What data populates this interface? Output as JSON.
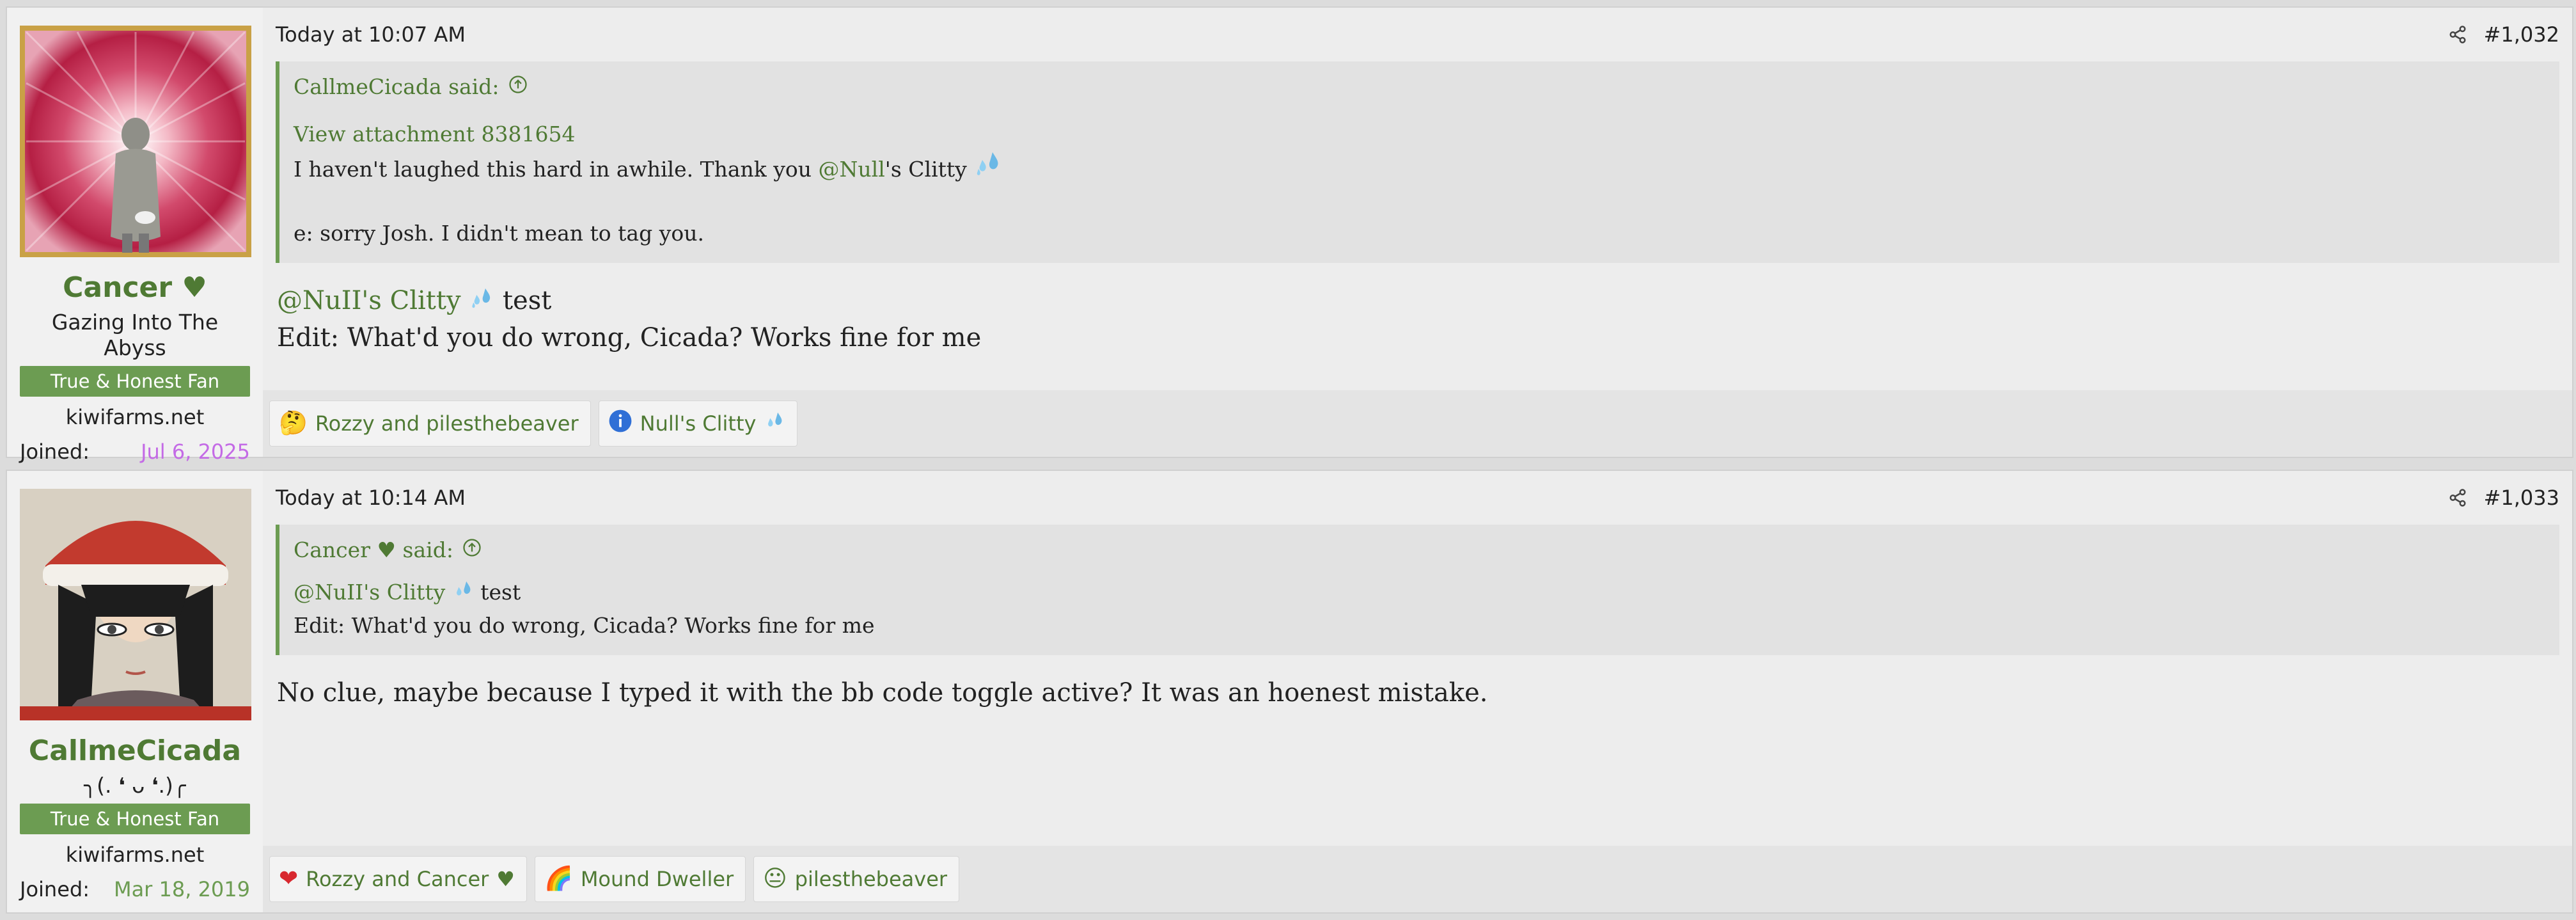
{
  "posts": [
    {
      "username": "Cancer",
      "username_heart": "♥",
      "user_title": "Gazing Into The Abyss",
      "banner": "True & Honest Fan",
      "site": "kiwifarms.net",
      "joined_label": "Joined:",
      "joined_date": "Jul 6, 2025",
      "timestamp": "Today at 10:07 AM",
      "post_number": "#1,032",
      "quote": {
        "author": "CallmeCicada said:",
        "attachment_link": "View attachment 8381654",
        "line1_pre": "I haven't laughed this hard in awhile. Thank you ",
        "mention": "@Null",
        "line1_post": "'s Clitty",
        "line2": "e: sorry Josh. I didn't mean to tag you."
      },
      "body_mention": "@NuII's Clitty",
      "body_line1_post": " test",
      "body_line2": "Edit: What'd you do wrong, Cicada? Works fine for me",
      "reactions": [
        {
          "icon": "thinking-emoji",
          "emoji": "🤔",
          "label": "Rozzy and pilesthebeaver"
        },
        {
          "icon": "info-icon",
          "emoji": "ℹ",
          "label": "Null's Clitty"
        }
      ]
    },
    {
      "username": "CallmeCicada",
      "user_title": "╮(. ❛ ᴗ ❛.)╭",
      "banner": "True & Honest Fan",
      "site": "kiwifarms.net",
      "joined_label": "Joined:",
      "joined_date": "Mar 18, 2019",
      "timestamp": "Today at 10:14 AM",
      "post_number": "#1,033",
      "quote": {
        "author": "Cancer",
        "author_heart": "♥",
        "author_suffix": " said:",
        "mention": "@NuII's Clitty",
        "line1_post": " test",
        "line2": "Edit: What'd you do wrong, Cicada? Works fine for me"
      },
      "body": "No clue, maybe because I typed it with the bb code toggle active? It was an hoenest mistake.",
      "reactions": [
        {
          "icon": "heart-emoji",
          "emoji": "❤",
          "label": "Rozzy and Cancer",
          "heart": "♥"
        },
        {
          "icon": "rainbow-emoji",
          "emoji": "🌈",
          "label": "Mound Dweller"
        },
        {
          "icon": "face-emoji",
          "emoji": "😐",
          "label": "pilesthebeaver"
        }
      ]
    }
  ],
  "colors": {
    "accent": "#4f7a34",
    "banner": "#6c9c52",
    "joined_pink": "#c46be6"
  }
}
